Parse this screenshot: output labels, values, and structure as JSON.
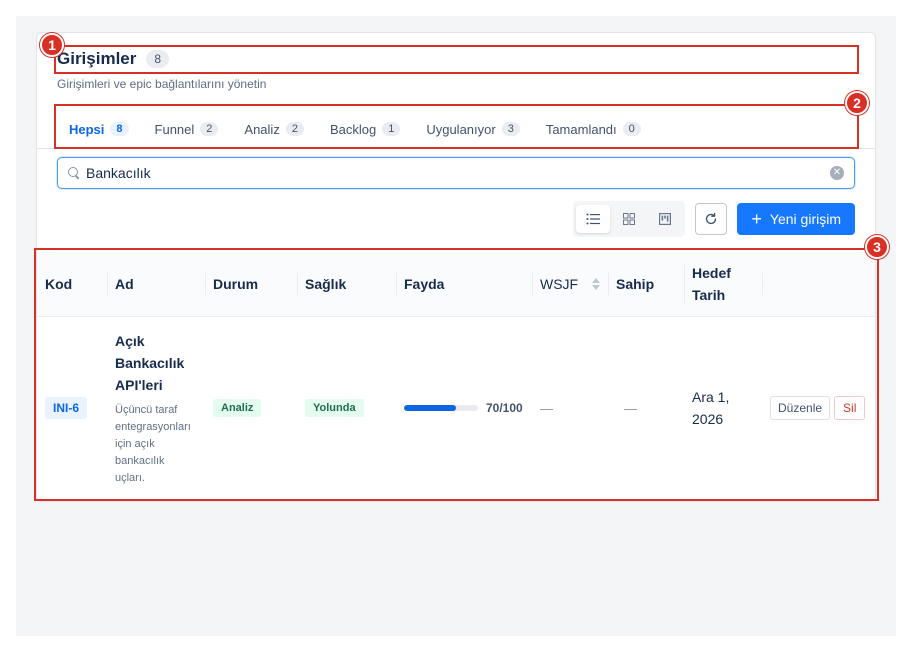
{
  "header": {
    "title": "Girişimler",
    "count": "8",
    "subtitle": "Girişimleri ve epic bağlantılarını yönetin"
  },
  "tabs": [
    {
      "label": "Hepsi",
      "count": "8"
    },
    {
      "label": "Funnel",
      "count": "2"
    },
    {
      "label": "Analiz",
      "count": "2"
    },
    {
      "label": "Backlog",
      "count": "1"
    },
    {
      "label": "Uygulanıyor",
      "count": "3"
    },
    {
      "label": "Tamamlandı",
      "count": "0"
    }
  ],
  "search": {
    "value": "Bankacılık",
    "icon": "search-icon",
    "clear_icon": "close-circle-icon"
  },
  "toolbar": {
    "views": [
      "list-view-icon",
      "grid-view-icon",
      "board-view-icon"
    ],
    "refresh_icon": "refresh-icon",
    "new_label": "Yeni girişim"
  },
  "table": {
    "columns": {
      "kod": "Kod",
      "ad": "Ad",
      "durum": "Durum",
      "saglik": "Sağlık",
      "fayda": "Fayda",
      "wsjf": "WSJF",
      "sahip": "Sahip",
      "hedef_1": "Hedef",
      "hedef_2": "Tarih"
    },
    "rows": [
      {
        "kod": "INI-6",
        "ad": "Açık Bankacılık API'leri",
        "description": "Üçüncü taraf entegrasyonları için açık bankacılık uçları.",
        "durum": "Analiz",
        "saglik": "Yolunda",
        "fayda_value": 70,
        "fayda_max": 100,
        "fayda_label": "70/100",
        "wsjf": "—",
        "sahip": "—",
        "hedef": "Ara 1, 2026",
        "edit_label": "Düzenle",
        "delete_label": "Sil"
      }
    ]
  },
  "annotations": [
    "1",
    "2",
    "3"
  ],
  "colors": {
    "accent": "#0c66e4",
    "primary_button": "#1677ff",
    "highlight": "#d93025",
    "success_bg": "#e3fcef"
  }
}
